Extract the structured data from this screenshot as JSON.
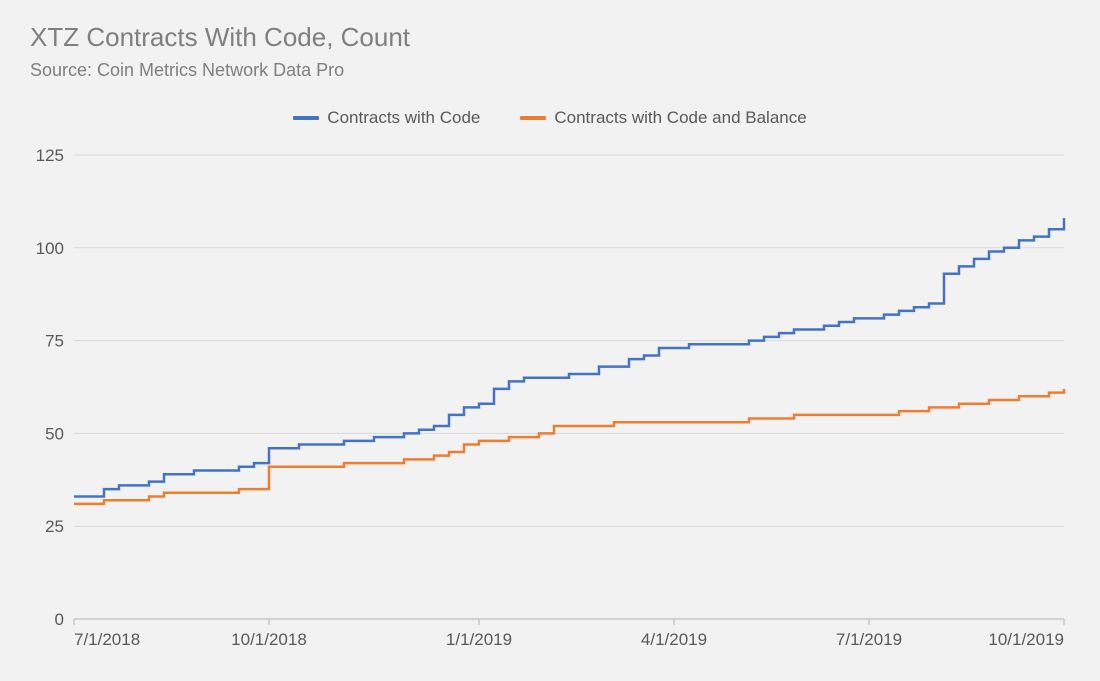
{
  "title": "XTZ Contracts With Code, Count",
  "subtitle": "Source: Coin Metrics Network Data Pro",
  "legend": {
    "a": "Contracts with Code",
    "b": "Contracts with Code and Balance"
  },
  "colors": {
    "a": "#4472c4",
    "b": "#ed7d31",
    "grid": "#d9d9d9",
    "axis": "#bfbfbf",
    "text": "#595959"
  },
  "chart_data": {
    "type": "line",
    "title": "XTZ Contracts With Code, Count",
    "xlabel": "",
    "ylabel": "",
    "ylim": [
      0,
      125
    ],
    "yticks": [
      0,
      25,
      50,
      75,
      100,
      125
    ],
    "xlim": [
      "7/1/2018",
      "10/1/2019"
    ],
    "xticks": [
      "7/1/2018",
      "10/1/2018",
      "1/1/2019",
      "4/1/2019",
      "7/1/2019",
      "10/1/2019"
    ],
    "x": [
      "7/1/2018",
      "7/8/2018",
      "7/15/2018",
      "7/22/2018",
      "7/29/2018",
      "8/5/2018",
      "8/12/2018",
      "8/19/2018",
      "8/26/2018",
      "9/2/2018",
      "9/9/2018",
      "9/16/2018",
      "9/23/2018",
      "9/30/2018",
      "10/7/2018",
      "10/14/2018",
      "10/21/2018",
      "10/28/2018",
      "11/4/2018",
      "11/11/2018",
      "11/18/2018",
      "11/25/2018",
      "12/2/2018",
      "12/9/2018",
      "12/16/2018",
      "12/23/2018",
      "12/30/2018",
      "1/6/2019",
      "1/13/2019",
      "1/20/2019",
      "1/27/2019",
      "2/3/2019",
      "2/10/2019",
      "2/17/2019",
      "2/24/2019",
      "3/3/2019",
      "3/10/2019",
      "3/17/2019",
      "3/24/2019",
      "3/31/2019",
      "4/7/2019",
      "4/14/2019",
      "4/21/2019",
      "4/28/2019",
      "5/5/2019",
      "5/12/2019",
      "5/19/2019",
      "5/26/2019",
      "6/2/2019",
      "6/9/2019",
      "6/16/2019",
      "6/23/2019",
      "6/30/2019",
      "7/7/2019",
      "7/14/2019",
      "7/21/2019",
      "7/28/2019",
      "8/4/2019",
      "8/11/2019",
      "8/18/2019",
      "8/25/2019",
      "9/1/2019",
      "9/8/2019",
      "9/15/2019",
      "9/22/2019",
      "9/29/2019",
      "10/1/2019"
    ],
    "series": [
      {
        "name": "Contracts with Code",
        "color": "#4472c4",
        "values": [
          33,
          33,
          35,
          36,
          36,
          37,
          39,
          39,
          40,
          40,
          40,
          41,
          42,
          46,
          46,
          47,
          47,
          47,
          48,
          48,
          49,
          49,
          50,
          51,
          52,
          55,
          57,
          58,
          62,
          64,
          65,
          65,
          65,
          66,
          66,
          68,
          68,
          70,
          71,
          73,
          73,
          74,
          74,
          74,
          74,
          75,
          76,
          77,
          78,
          78,
          79,
          80,
          81,
          81,
          82,
          83,
          84,
          85,
          93,
          95,
          97,
          99,
          100,
          102,
          103,
          105,
          108
        ]
      },
      {
        "name": "Contracts with Code and Balance",
        "color": "#ed7d31",
        "values": [
          31,
          31,
          32,
          32,
          32,
          33,
          34,
          34,
          34,
          34,
          34,
          35,
          35,
          41,
          41,
          41,
          41,
          41,
          42,
          42,
          42,
          42,
          43,
          43,
          44,
          45,
          47,
          48,
          48,
          49,
          49,
          50,
          52,
          52,
          52,
          52,
          53,
          53,
          53,
          53,
          53,
          53,
          53,
          53,
          53,
          54,
          54,
          54,
          55,
          55,
          55,
          55,
          55,
          55,
          55,
          56,
          56,
          57,
          57,
          58,
          58,
          59,
          59,
          60,
          60,
          61,
          62
        ]
      }
    ]
  }
}
